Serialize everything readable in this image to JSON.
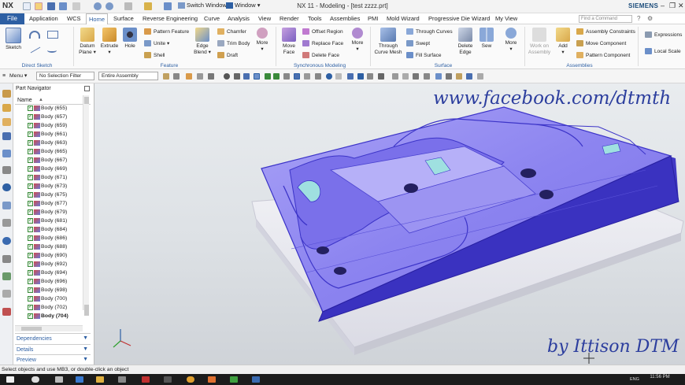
{
  "app": {
    "logo": "NX",
    "title": "NX 11 - Modeling - [test zzzz.prt]",
    "brand": "SIEMENS",
    "switch_window": "Switch Window",
    "window_menu": "Window ▾",
    "window_buttons": [
      "–",
      "❐",
      "✕"
    ]
  },
  "tabs": {
    "file": "File",
    "items": [
      "Application",
      "WCS",
      "Home",
      "Surface",
      "Reverse Engineering",
      "Curve",
      "Analysis",
      "View",
      "Render",
      "Tools",
      "Assemblies",
      "PMI",
      "Mold Wizard",
      "Progressive Die Wizard",
      "My View"
    ],
    "active": "Home",
    "search_placeholder": "Find a Command"
  },
  "ribbon": {
    "sketch": "Sketch",
    "direct_sketch_group": "Direct Sketch",
    "datum_plane": "Datum\nPlane ▾",
    "extrude": "Extrude\n▾",
    "hole": "Hole",
    "pattern_feature": "Pattern Feature",
    "unite": "Unite ▾",
    "shell": "Shell",
    "edge_blend": "Edge\nBlend ▾",
    "chamfer": "Chamfer",
    "trim_body": "Trim Body",
    "draft": "Draft",
    "more1": "More\n▾",
    "feature_group": "Feature",
    "move_face": "Move\nFace",
    "offset_region": "Offset Region",
    "replace_face": "Replace Face",
    "delete_face": "Delete Face",
    "more2": "More\n▾",
    "sync_group": "Synchronous Modeling",
    "through_curve_mesh": "Through\nCurve Mesh",
    "through_curves": "Through Curves",
    "swept": "Swept",
    "fill_surface": "Fill Surface",
    "delete_edge": "Delete\nEdge",
    "sew": "Sew",
    "more3": "More\n▾",
    "surface_group": "Surface",
    "work_on_assembly": "Work on\nAssembly",
    "add": "Add\n▾",
    "assembly_constraints": "Assembly Constraints",
    "move_component": "Move Component",
    "pattern_component": "Pattern Component",
    "assemblies_group": "Assemblies",
    "expressions": "Expressions",
    "local_scale": "Local Scale"
  },
  "selection_bar": {
    "menu": "Menu ▾",
    "filter": "No Selection Filter",
    "scope": "Entire Assembly"
  },
  "part_navigator": {
    "title": "Part Navigator",
    "column_name": "Name",
    "items": [
      "Body (655)",
      "Body (657)",
      "Body (659)",
      "Body (661)",
      "Body (663)",
      "Body (665)",
      "Body (667)",
      "Body (669)",
      "Body (671)",
      "Body (673)",
      "Body (675)",
      "Body (677)",
      "Body (679)",
      "Body (681)",
      "Body (684)",
      "Body (686)",
      "Body (688)",
      "Body (690)",
      "Body (692)",
      "Body (694)",
      "Body (696)",
      "Body (698)",
      "Body (700)",
      "Body (702)",
      "Body (704)"
    ],
    "dependencies": "Dependencies",
    "details": "Details",
    "preview": "Preview"
  },
  "watermarks": {
    "top": "www.facebook.com/dtmth",
    "bottom": "by Ittison DTM"
  },
  "status": "Select objects and use MB3, or double-click an object",
  "taskbar": {
    "language": "ENG",
    "time": "11:56 PM"
  },
  "colors": {
    "accent": "#2d5fa3",
    "model_top": "#8c84f0",
    "model_edge": "#3c34c8",
    "highlight": "#9fe0e0"
  }
}
